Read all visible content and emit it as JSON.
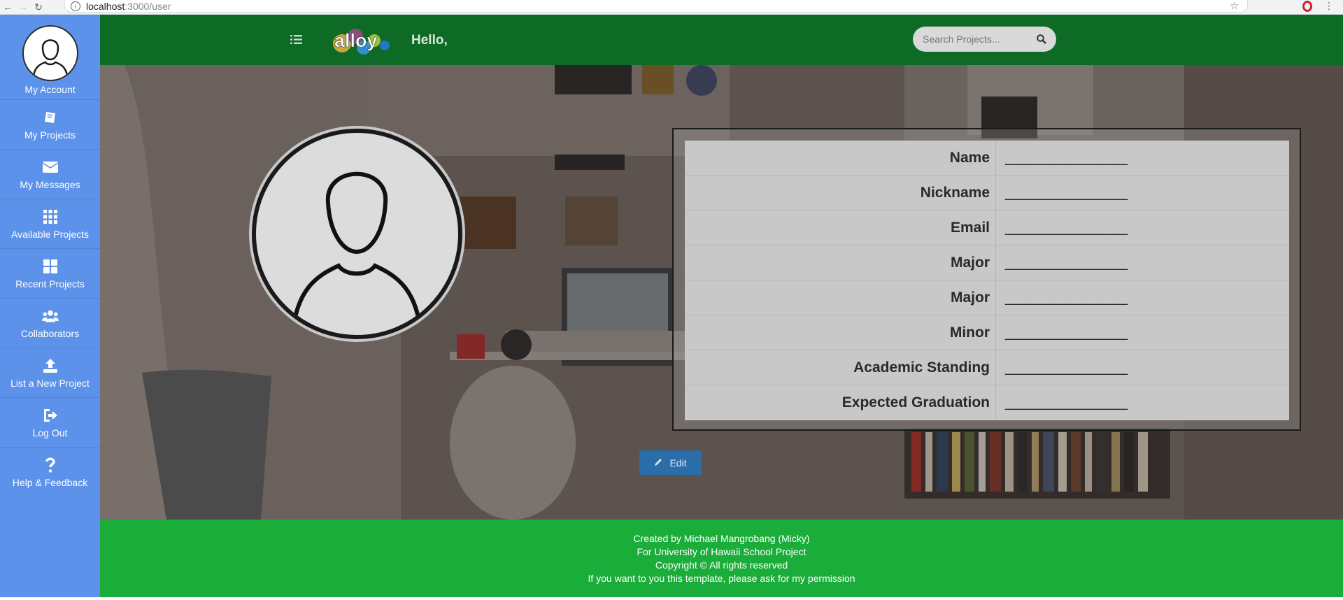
{
  "browser": {
    "url_host": "localhost",
    "url_path": ":3000/user"
  },
  "sidebar": {
    "account_label": "My Account",
    "items": [
      {
        "label": "My Projects",
        "icon": "book-icon"
      },
      {
        "label": "My Messages",
        "icon": "envelope-icon"
      },
      {
        "label": "Available Projects",
        "icon": "grid-icon"
      },
      {
        "label": "Recent Projects",
        "icon": "large-grid-icon"
      },
      {
        "label": "Collaborators",
        "icon": "users-icon"
      },
      {
        "label": "List a New Project",
        "icon": "upload-icon"
      },
      {
        "label": "Log Out",
        "icon": "sign-out-icon"
      },
      {
        "label": "Help & Feedback",
        "icon": "question-icon"
      }
    ]
  },
  "header": {
    "logo_text": "alloy",
    "greeting": "Hello,",
    "search_placeholder": "Search Projects..."
  },
  "profile": {
    "fields": [
      {
        "label": "Name",
        "value": "_______________"
      },
      {
        "label": "Nickname",
        "value": "_______________"
      },
      {
        "label": "Email",
        "value": "_______________"
      },
      {
        "label": "Major",
        "value": "_______________"
      },
      {
        "label": "Major",
        "value": "_______________"
      },
      {
        "label": "Minor",
        "value": "_______________"
      },
      {
        "label": "Academic Standing",
        "value": "_______________"
      },
      {
        "label": "Expected Graduation",
        "value": "_______________"
      }
    ],
    "edit_label": "Edit"
  },
  "footer": {
    "line1": "Created by Michael Mangrobang (Micky)",
    "line2": "For University of Hawaii School Project",
    "line3": "Copyright © All rights reserved",
    "line4": "If you want to you this template, please ask for my permission"
  },
  "colors": {
    "sidebar": "#5d92ea",
    "topbar": "#0e6b26",
    "footer": "#1bad3a",
    "edit_button": "#2a6da8"
  }
}
